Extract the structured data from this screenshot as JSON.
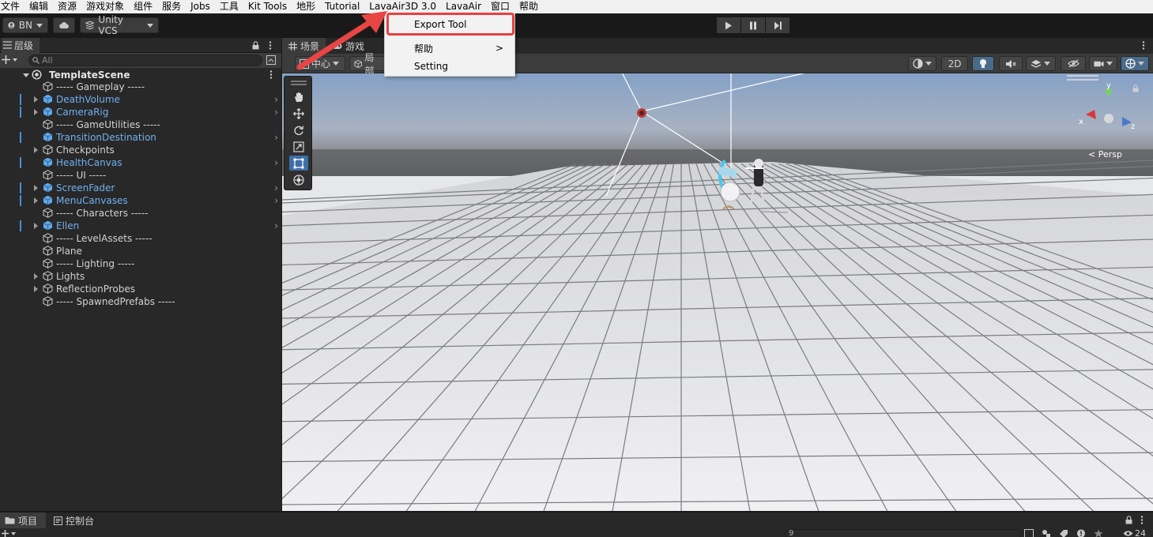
{
  "menubar": {
    "items": [
      "文件",
      "编辑",
      "资源",
      "游戏对象",
      "组件",
      "服务",
      "Jobs",
      "工具",
      "Kit Tools",
      "地形",
      "Tutorial",
      "LavaAir3D 3.0",
      "LavaAir",
      "窗口",
      "帮助"
    ]
  },
  "toolbar": {
    "account_label": "BN",
    "vcs_label": "Unity VCS"
  },
  "dropdown": {
    "items": [
      {
        "label": "Export Tool",
        "highlighted": true
      },
      {
        "label": "帮助",
        "has_submenu": true
      },
      {
        "label": "Setting"
      }
    ],
    "submenu_glyph": ">"
  },
  "hierarchy": {
    "tab_label": "层级",
    "search_placeholder": "All",
    "scene_name": "TemplateScene",
    "items": [
      {
        "label": "----- Gameplay -----",
        "prefab": false,
        "expandable": false
      },
      {
        "label": "DeathVolume",
        "prefab": true,
        "expandable": true
      },
      {
        "label": "CameraRig",
        "prefab": true,
        "expandable": true
      },
      {
        "label": "----- GameUtilities -----",
        "prefab": false,
        "expandable": false
      },
      {
        "label": "TransitionDestination",
        "prefab": true,
        "expandable": false
      },
      {
        "label": "Checkpoints",
        "prefab": false,
        "expandable": true
      },
      {
        "label": "HealthCanvas",
        "prefab": true,
        "expandable": false
      },
      {
        "label": "----- UI -----",
        "prefab": false,
        "expandable": false
      },
      {
        "label": "ScreenFader",
        "prefab": true,
        "expandable": true
      },
      {
        "label": "MenuCanvases",
        "prefab": true,
        "expandable": true
      },
      {
        "label": "----- Characters -----",
        "prefab": false,
        "expandable": false
      },
      {
        "label": "Ellen",
        "prefab": true,
        "expandable": true
      },
      {
        "label": "----- LevelAssets -----",
        "prefab": false,
        "expandable": false
      },
      {
        "label": "Plane",
        "prefab": false,
        "expandable": false
      },
      {
        "label": "----- Lighting -----",
        "prefab": false,
        "expandable": false
      },
      {
        "label": "Lights",
        "prefab": false,
        "expandable": true
      },
      {
        "label": "ReflectionProbes",
        "prefab": false,
        "expandable": true
      },
      {
        "label": "----- SpawnedPrefabs -----",
        "prefab": false,
        "expandable": false
      }
    ]
  },
  "scene": {
    "tabs": [
      "场景",
      "游戏"
    ],
    "pivot_label": "中心",
    "local_label": "局部",
    "mode_2d": "2D",
    "gizmo_label": "< Persp"
  },
  "bottom": {
    "tabs": [
      "项目",
      "控制台"
    ],
    "search_value": "9",
    "badge_count": "24"
  },
  "colors": {
    "accent_red": "#e84040",
    "prefab_blue": "#6fb0f0",
    "selected_tool": "#3d6ea8"
  }
}
